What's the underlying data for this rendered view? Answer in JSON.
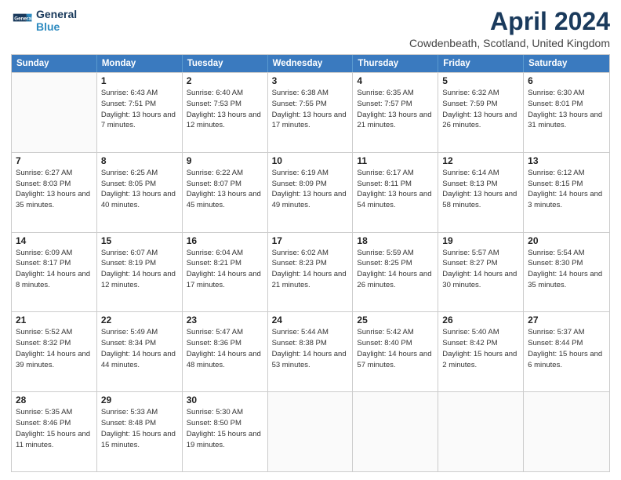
{
  "header": {
    "logo_line1": "General",
    "logo_line2": "Blue",
    "main_title": "April 2024",
    "subtitle": "Cowdenbeath, Scotland, United Kingdom"
  },
  "calendar": {
    "headers": [
      "Sunday",
      "Monday",
      "Tuesday",
      "Wednesday",
      "Thursday",
      "Friday",
      "Saturday"
    ],
    "rows": [
      [
        {
          "day": "",
          "sunrise": "",
          "sunset": "",
          "daylight": ""
        },
        {
          "day": "1",
          "sunrise": "Sunrise: 6:43 AM",
          "sunset": "Sunset: 7:51 PM",
          "daylight": "Daylight: 13 hours and 7 minutes."
        },
        {
          "day": "2",
          "sunrise": "Sunrise: 6:40 AM",
          "sunset": "Sunset: 7:53 PM",
          "daylight": "Daylight: 13 hours and 12 minutes."
        },
        {
          "day": "3",
          "sunrise": "Sunrise: 6:38 AM",
          "sunset": "Sunset: 7:55 PM",
          "daylight": "Daylight: 13 hours and 17 minutes."
        },
        {
          "day": "4",
          "sunrise": "Sunrise: 6:35 AM",
          "sunset": "Sunset: 7:57 PM",
          "daylight": "Daylight: 13 hours and 21 minutes."
        },
        {
          "day": "5",
          "sunrise": "Sunrise: 6:32 AM",
          "sunset": "Sunset: 7:59 PM",
          "daylight": "Daylight: 13 hours and 26 minutes."
        },
        {
          "day": "6",
          "sunrise": "Sunrise: 6:30 AM",
          "sunset": "Sunset: 8:01 PM",
          "daylight": "Daylight: 13 hours and 31 minutes."
        }
      ],
      [
        {
          "day": "7",
          "sunrise": "Sunrise: 6:27 AM",
          "sunset": "Sunset: 8:03 PM",
          "daylight": "Daylight: 13 hours and 35 minutes."
        },
        {
          "day": "8",
          "sunrise": "Sunrise: 6:25 AM",
          "sunset": "Sunset: 8:05 PM",
          "daylight": "Daylight: 13 hours and 40 minutes."
        },
        {
          "day": "9",
          "sunrise": "Sunrise: 6:22 AM",
          "sunset": "Sunset: 8:07 PM",
          "daylight": "Daylight: 13 hours and 45 minutes."
        },
        {
          "day": "10",
          "sunrise": "Sunrise: 6:19 AM",
          "sunset": "Sunset: 8:09 PM",
          "daylight": "Daylight: 13 hours and 49 minutes."
        },
        {
          "day": "11",
          "sunrise": "Sunrise: 6:17 AM",
          "sunset": "Sunset: 8:11 PM",
          "daylight": "Daylight: 13 hours and 54 minutes."
        },
        {
          "day": "12",
          "sunrise": "Sunrise: 6:14 AM",
          "sunset": "Sunset: 8:13 PM",
          "daylight": "Daylight: 13 hours and 58 minutes."
        },
        {
          "day": "13",
          "sunrise": "Sunrise: 6:12 AM",
          "sunset": "Sunset: 8:15 PM",
          "daylight": "Daylight: 14 hours and 3 minutes."
        }
      ],
      [
        {
          "day": "14",
          "sunrise": "Sunrise: 6:09 AM",
          "sunset": "Sunset: 8:17 PM",
          "daylight": "Daylight: 14 hours and 8 minutes."
        },
        {
          "day": "15",
          "sunrise": "Sunrise: 6:07 AM",
          "sunset": "Sunset: 8:19 PM",
          "daylight": "Daylight: 14 hours and 12 minutes."
        },
        {
          "day": "16",
          "sunrise": "Sunrise: 6:04 AM",
          "sunset": "Sunset: 8:21 PM",
          "daylight": "Daylight: 14 hours and 17 minutes."
        },
        {
          "day": "17",
          "sunrise": "Sunrise: 6:02 AM",
          "sunset": "Sunset: 8:23 PM",
          "daylight": "Daylight: 14 hours and 21 minutes."
        },
        {
          "day": "18",
          "sunrise": "Sunrise: 5:59 AM",
          "sunset": "Sunset: 8:25 PM",
          "daylight": "Daylight: 14 hours and 26 minutes."
        },
        {
          "day": "19",
          "sunrise": "Sunrise: 5:57 AM",
          "sunset": "Sunset: 8:27 PM",
          "daylight": "Daylight: 14 hours and 30 minutes."
        },
        {
          "day": "20",
          "sunrise": "Sunrise: 5:54 AM",
          "sunset": "Sunset: 8:30 PM",
          "daylight": "Daylight: 14 hours and 35 minutes."
        }
      ],
      [
        {
          "day": "21",
          "sunrise": "Sunrise: 5:52 AM",
          "sunset": "Sunset: 8:32 PM",
          "daylight": "Daylight: 14 hours and 39 minutes."
        },
        {
          "day": "22",
          "sunrise": "Sunrise: 5:49 AM",
          "sunset": "Sunset: 8:34 PM",
          "daylight": "Daylight: 14 hours and 44 minutes."
        },
        {
          "day": "23",
          "sunrise": "Sunrise: 5:47 AM",
          "sunset": "Sunset: 8:36 PM",
          "daylight": "Daylight: 14 hours and 48 minutes."
        },
        {
          "day": "24",
          "sunrise": "Sunrise: 5:44 AM",
          "sunset": "Sunset: 8:38 PM",
          "daylight": "Daylight: 14 hours and 53 minutes."
        },
        {
          "day": "25",
          "sunrise": "Sunrise: 5:42 AM",
          "sunset": "Sunset: 8:40 PM",
          "daylight": "Daylight: 14 hours and 57 minutes."
        },
        {
          "day": "26",
          "sunrise": "Sunrise: 5:40 AM",
          "sunset": "Sunset: 8:42 PM",
          "daylight": "Daylight: 15 hours and 2 minutes."
        },
        {
          "day": "27",
          "sunrise": "Sunrise: 5:37 AM",
          "sunset": "Sunset: 8:44 PM",
          "daylight": "Daylight: 15 hours and 6 minutes."
        }
      ],
      [
        {
          "day": "28",
          "sunrise": "Sunrise: 5:35 AM",
          "sunset": "Sunset: 8:46 PM",
          "daylight": "Daylight: 15 hours and 11 minutes."
        },
        {
          "day": "29",
          "sunrise": "Sunrise: 5:33 AM",
          "sunset": "Sunset: 8:48 PM",
          "daylight": "Daylight: 15 hours and 15 minutes."
        },
        {
          "day": "30",
          "sunrise": "Sunrise: 5:30 AM",
          "sunset": "Sunset: 8:50 PM",
          "daylight": "Daylight: 15 hours and 19 minutes."
        },
        {
          "day": "",
          "sunrise": "",
          "sunset": "",
          "daylight": ""
        },
        {
          "day": "",
          "sunrise": "",
          "sunset": "",
          "daylight": ""
        },
        {
          "day": "",
          "sunrise": "",
          "sunset": "",
          "daylight": ""
        },
        {
          "day": "",
          "sunrise": "",
          "sunset": "",
          "daylight": ""
        }
      ]
    ]
  }
}
